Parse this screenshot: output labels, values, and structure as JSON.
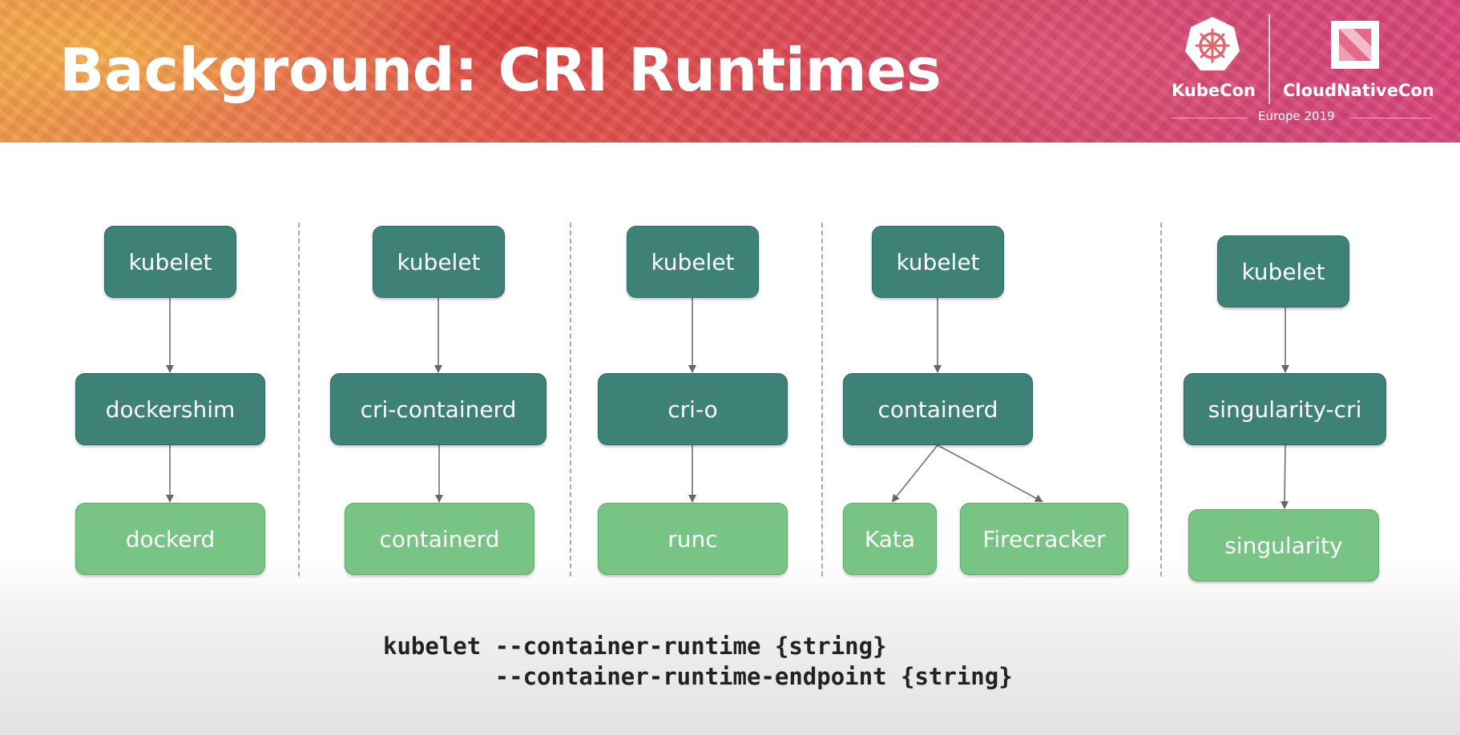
{
  "title": "Background: CRI Runtimes",
  "logos": {
    "kubecon": "KubeCon",
    "cloudnativecon": "CloudNativeCon",
    "event": "Europe 2019",
    "kubecon_icon": "helm-wheel-icon",
    "cncf_icon": "cncf-icon"
  },
  "colors": {
    "node_dark": "#3d8177",
    "node_light": "#77c484",
    "divider": "#a9a9a9"
  },
  "stacks": [
    {
      "kubelet": "kubelet",
      "shim": "dockershim",
      "runtimes": [
        "dockerd"
      ]
    },
    {
      "kubelet": "kubelet",
      "shim": "cri-containerd",
      "runtimes": [
        "containerd"
      ]
    },
    {
      "kubelet": "kubelet",
      "shim": "cri-o",
      "runtimes": [
        "runc"
      ]
    },
    {
      "kubelet": "kubelet",
      "shim": "containerd",
      "runtimes": [
        "Kata",
        "Firecracker"
      ]
    },
    {
      "kubelet": "kubelet",
      "shim": "singularity-cri",
      "runtimes": [
        "singularity"
      ]
    }
  ],
  "command": {
    "line1": "kubelet --container-runtime {string}",
    "line2": "        --container-runtime-endpoint {string}"
  }
}
